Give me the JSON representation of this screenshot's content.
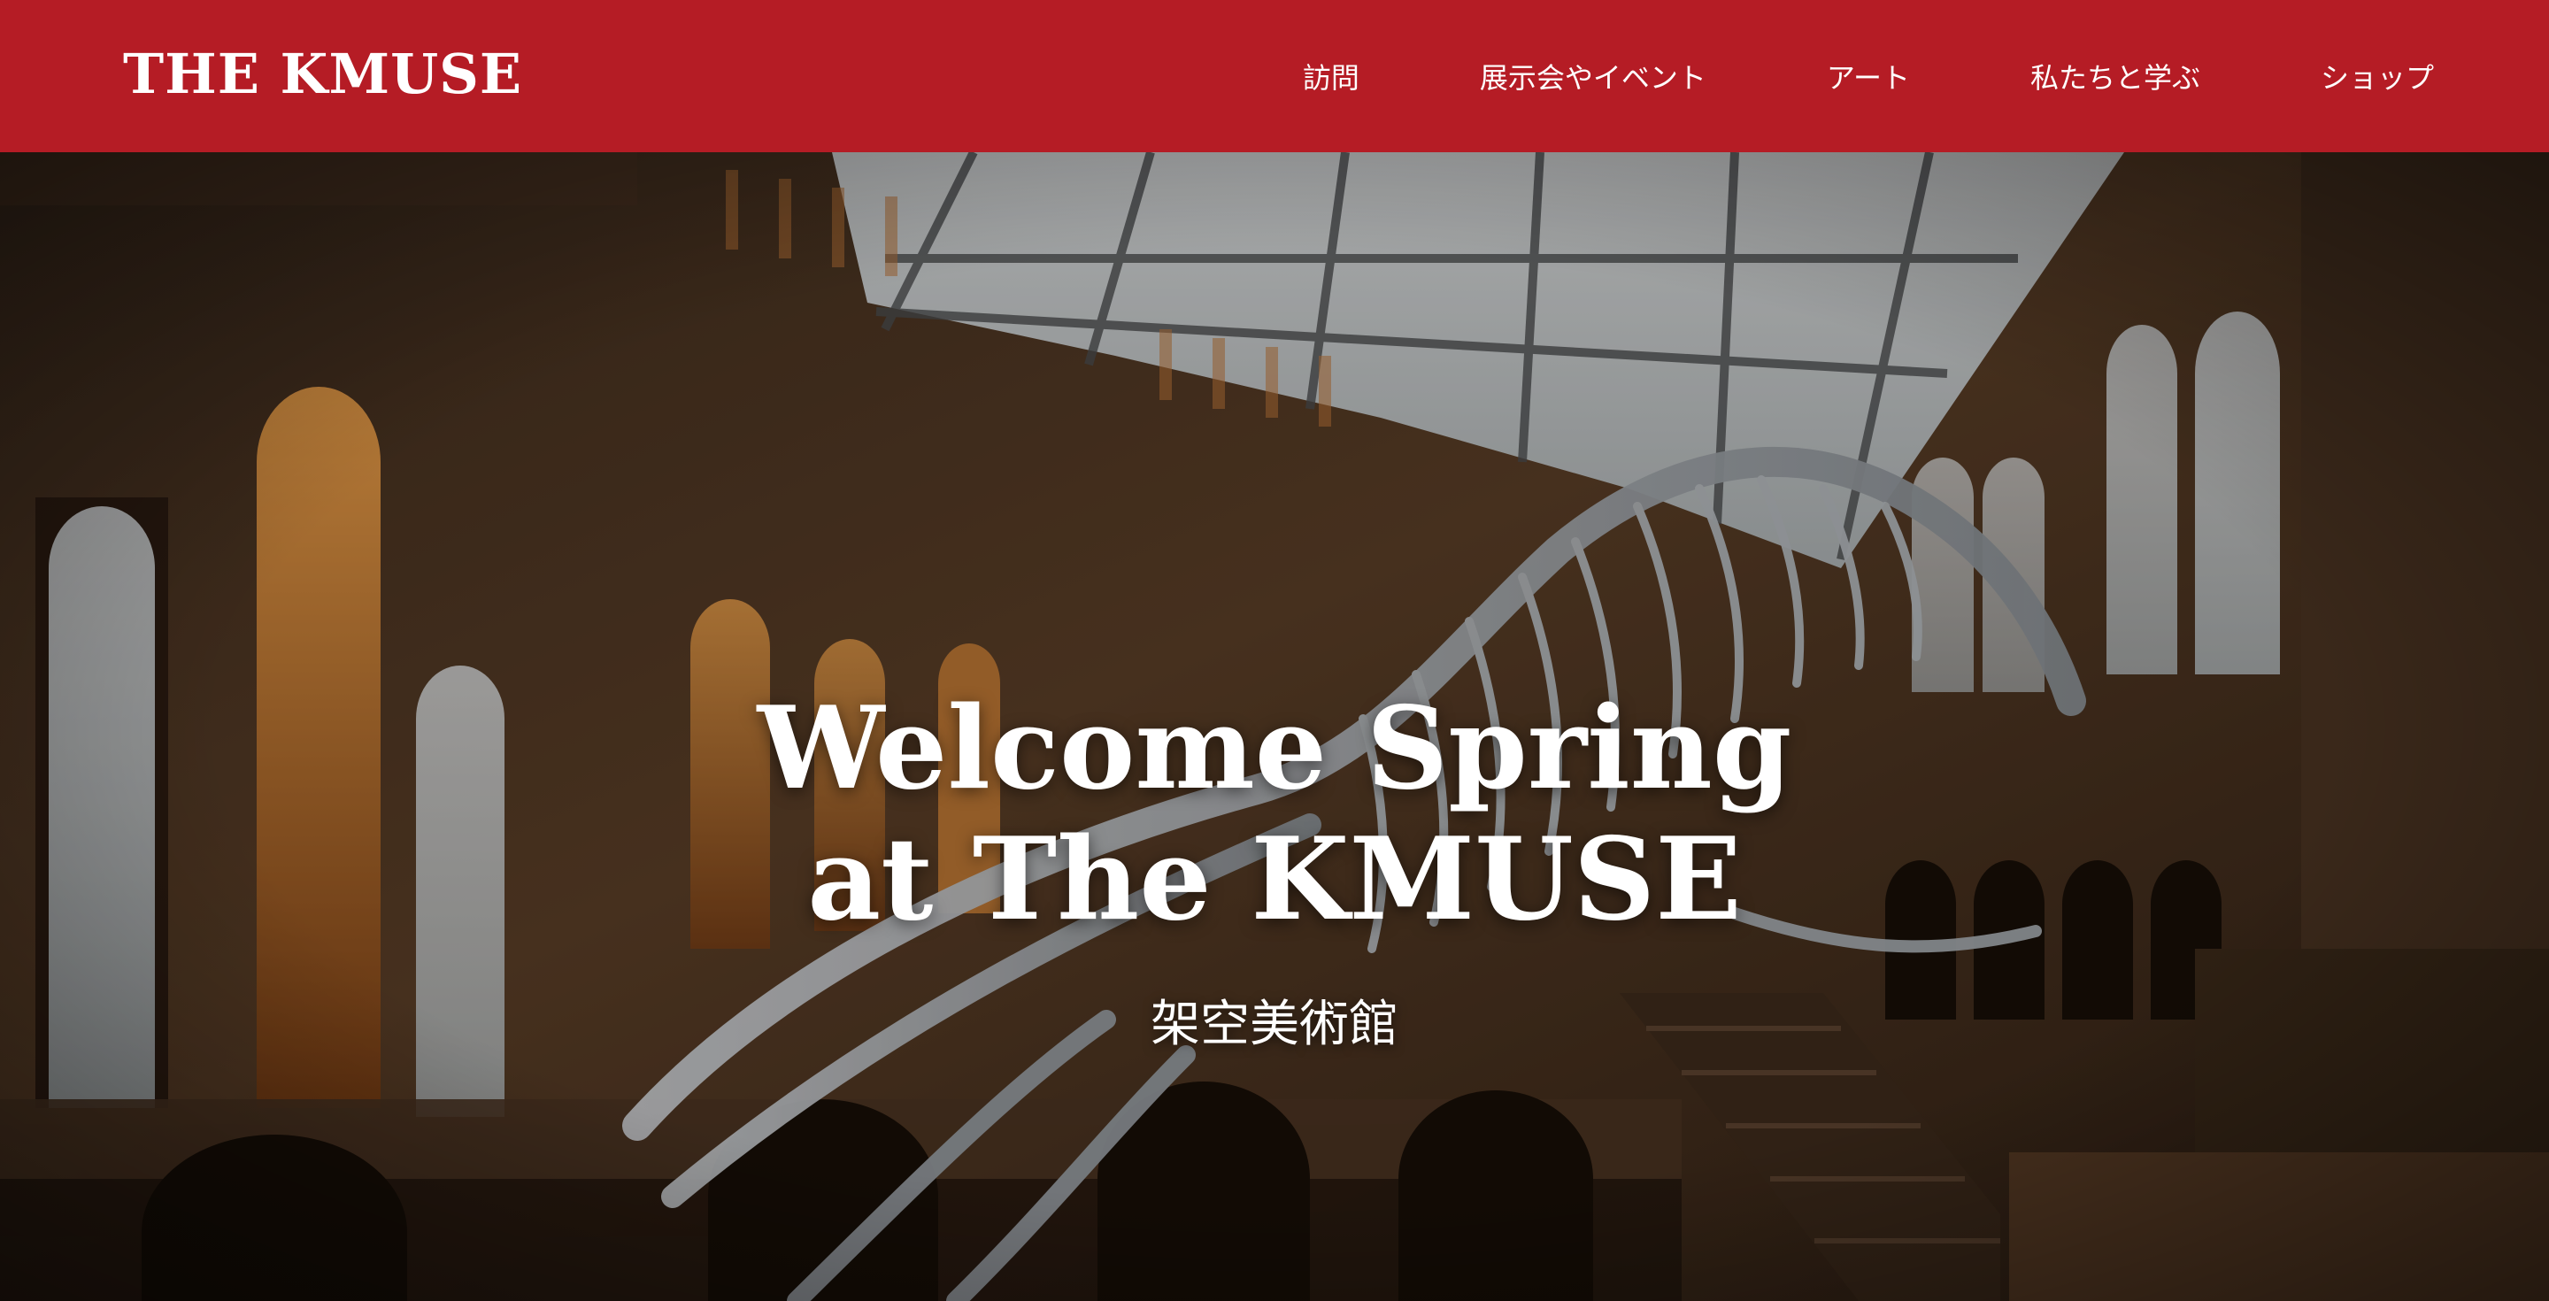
{
  "header": {
    "logo": "THE KMUSE",
    "nav": [
      {
        "label": "訪問"
      },
      {
        "label": "展示会やイベント"
      },
      {
        "label": "アート"
      },
      {
        "label": "私たちと学ぶ"
      },
      {
        "label": "ショップ"
      }
    ]
  },
  "hero": {
    "title_line1": "Welcome Spring",
    "title_line2": "at The KMUSE",
    "subtitle": "架空美術館",
    "image_subject": "museum hall with suspended whale skeleton"
  },
  "colors": {
    "header_bg": "#b51c25",
    "text": "#ffffff"
  }
}
